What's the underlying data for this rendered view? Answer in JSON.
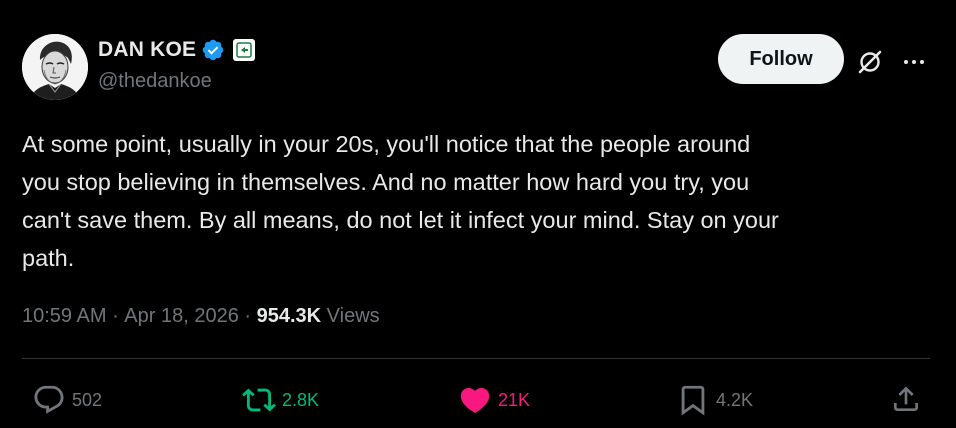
{
  "author": {
    "name": "DAN KOE",
    "handle": "@thedankoe"
  },
  "follow_button": {
    "label": "Follow"
  },
  "tweet": {
    "text": "At some point, usually in your 20s, you'll notice that the people around\nyou stop believing in themselves. And no matter how hard you try, you\ncan't save them. By all means, do not let it infect your mind. Stay on your\npath."
  },
  "meta": {
    "time": "10:59 AM",
    "separator1": " · ",
    "date": "Apr 18, 2026",
    "separator2": " · ",
    "views_count": "954.3K",
    "views_label": " Views"
  },
  "actions": {
    "replies": "502",
    "reposts": "2.8K",
    "likes": "21K",
    "bookmarks": "4.2K"
  },
  "colors": {
    "background": "#000000",
    "text": "#e7e9ea",
    "muted": "#71767b",
    "verified": "#1d9bf0",
    "repost_active": "#00ba7c",
    "like_active": "#f91880"
  },
  "icons": {
    "verified": "verified-badge-icon",
    "affiliate": "affiliate-badge-icon",
    "grok": "grok-icon",
    "more": "more-icon",
    "reply": "reply-icon",
    "repost": "repost-icon",
    "like": "heart-icon",
    "bookmark": "bookmark-icon",
    "share": "share-icon"
  }
}
